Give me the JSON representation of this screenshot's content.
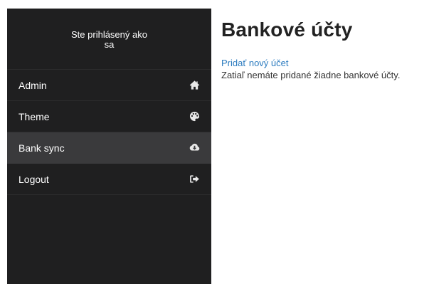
{
  "sidebar": {
    "header": {
      "line1": "Ste prihlásený ako",
      "line2": "sa"
    },
    "items": [
      {
        "label": "Admin",
        "icon": "home-icon",
        "active": false
      },
      {
        "label": "Theme",
        "icon": "palette-icon",
        "active": false
      },
      {
        "label": "Bank sync",
        "icon": "cloud-download-icon",
        "active": true
      },
      {
        "label": "Logout",
        "icon": "sign-out-icon",
        "active": false
      }
    ]
  },
  "main": {
    "title": "Bankové účty",
    "add_link": "Pridať nový účet",
    "empty_message": "Zatiaľ nemáte pridané žiadne bankové účty."
  },
  "colors": {
    "sidebar_bg": "#1f1f20",
    "active_item_bg": "#3a3a3c",
    "link": "#2b7bbf",
    "title": "#222222"
  }
}
